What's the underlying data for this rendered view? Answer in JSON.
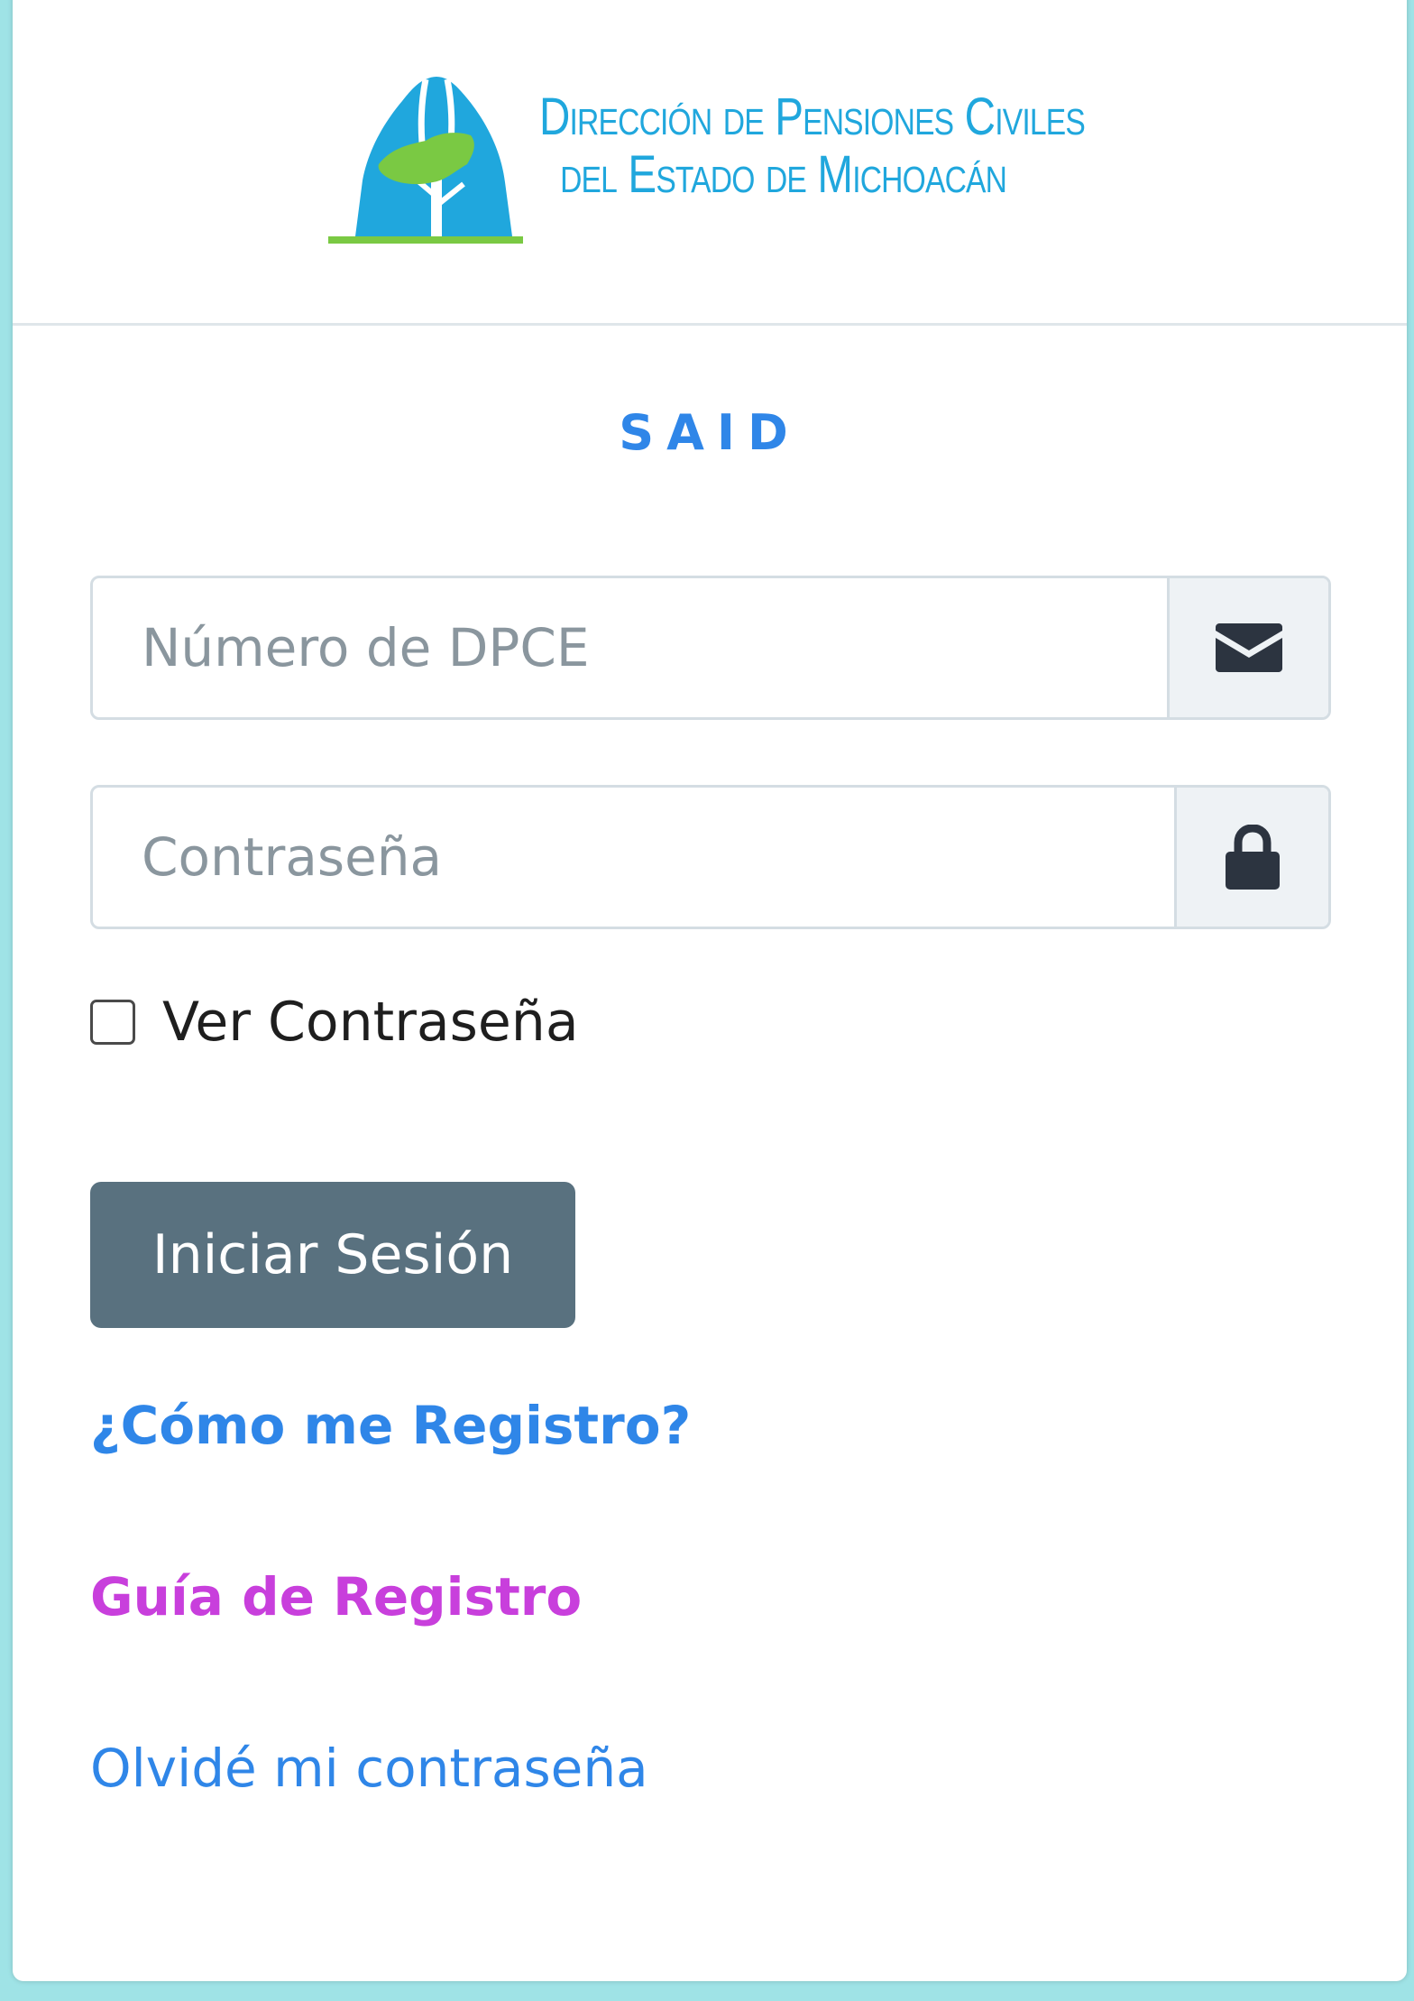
{
  "brand": {
    "line1": "Dirección de Pensiones Civiles",
    "line2": "del Estado de Michoacán",
    "logo_icon": "dpce-tree-logo",
    "colors": {
      "blue": "#20a7dd",
      "green": "#7ac943"
    }
  },
  "app": {
    "title": "SAID"
  },
  "form": {
    "dpce_placeholder": "Número de DPCE",
    "dpce_value": "",
    "dpce_icon": "envelope-icon",
    "password_placeholder": "Contraseña",
    "password_value": "",
    "password_icon": "lock-icon",
    "show_password_label": "Ver Contraseña",
    "show_password_checked": false,
    "submit_label": "Iniciar Sesión"
  },
  "links": {
    "how_register": "¿Cómo me Registro?",
    "register_guide": "Guía de Registro",
    "forgot_password": "Olvidé mi contraseña"
  },
  "colors": {
    "primary_link": "#2f86e8",
    "guide_link": "#c83fdc",
    "button": "#59717f",
    "page_background": "#9fe3e6"
  }
}
